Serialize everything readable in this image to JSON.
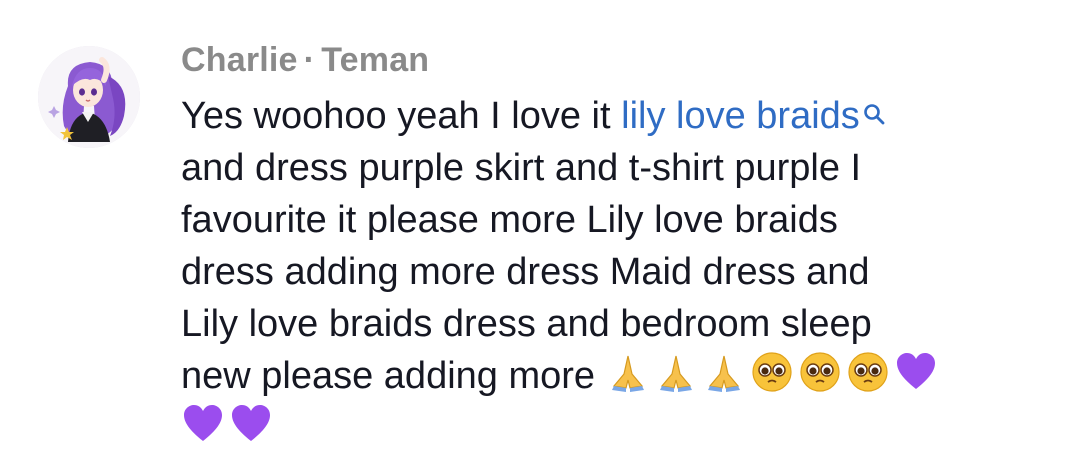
{
  "comment": {
    "author": "Charlie",
    "separator": "·",
    "relation": "Teman",
    "lines": [
      "Yes woohoo yeah I love it ",
      "and dress purple skirt and t-shirt purple I",
      "favourite it please more Lily love braids",
      "dress adding more dress Maid dress and",
      "Lily love braids dress and bedroom sleep",
      "new please adding more "
    ],
    "search_link": "lily love braids",
    "emojis_line6": [
      "folded-hands",
      "folded-hands",
      "folded-hands",
      "pleading-face",
      "pleading-face",
      "pleading-face",
      "purple-heart"
    ],
    "emojis_line7": [
      "purple-heart",
      "purple-heart"
    ]
  },
  "colors": {
    "author": "#8a8a8a",
    "text": "#161823",
    "link": "#2f6cc4",
    "heart": "#9b4dee"
  }
}
